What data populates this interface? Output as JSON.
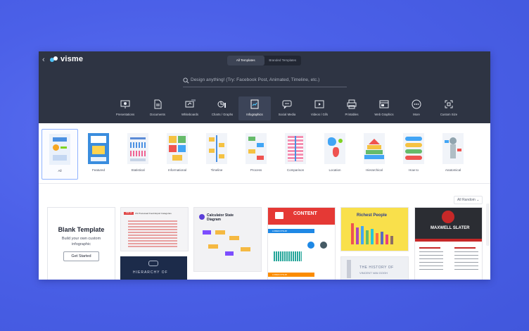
{
  "app": {
    "brand": "visme"
  },
  "toggle": {
    "all_templates": "All Templates",
    "branded_templates": "Branded Templates"
  },
  "search": {
    "placeholder": "Design anything! (Try: Facebook Post, Animated, Timeline, etc.)"
  },
  "categories": [
    {
      "label": "Presentations",
      "icon": "presentation-icon"
    },
    {
      "label": "Documents",
      "icon": "document-icon"
    },
    {
      "label": "Whiteboards",
      "icon": "whiteboard-icon",
      "badge": "NEW"
    },
    {
      "label": "Charts / Graphs",
      "icon": "chart-icon"
    },
    {
      "label": "Infographics",
      "icon": "infographic-icon"
    },
    {
      "label": "Social Media",
      "icon": "social-media-icon"
    },
    {
      "label": "Videos / Gifs",
      "icon": "video-icon"
    },
    {
      "label": "Printables",
      "icon": "printer-icon"
    },
    {
      "label": "Web Graphics",
      "icon": "web-graphic-icon"
    },
    {
      "label": "More",
      "icon": "more-icon"
    },
    {
      "label": "Custom Size",
      "icon": "custom-size-icon"
    }
  ],
  "subcategories": [
    {
      "label": "All"
    },
    {
      "label": "Featured"
    },
    {
      "label": "Statistical"
    },
    {
      "label": "Informational"
    },
    {
      "label": "Timeline"
    },
    {
      "label": "Process"
    },
    {
      "label": "Comparison"
    },
    {
      "label": "Location"
    },
    {
      "label": "Hierarchical"
    },
    {
      "label": "How to"
    },
    {
      "label": "Anatomical"
    }
  ],
  "sort": {
    "label": "All Random"
  },
  "blank": {
    "title": "Blank Template",
    "desc": "Build your own custom infographic",
    "button": "Get Started"
  },
  "templates": {
    "t1_title": "US Processed Food Export Categories",
    "t1_tag": "TOP 10",
    "t2_title": "Calculator State Diagram",
    "t3_title": "CONTENT",
    "t3_sub": "LOREM IPSUM",
    "t3_sub2": "LOREM IPSUM",
    "t4_title": "Richest People",
    "t4_history": "THE HISTORY OF",
    "t4_history2": "VINCENT VAN GOGH",
    "t5_title": "MAXWELL SLATER",
    "t6_title": "HIERARCHY OF"
  }
}
